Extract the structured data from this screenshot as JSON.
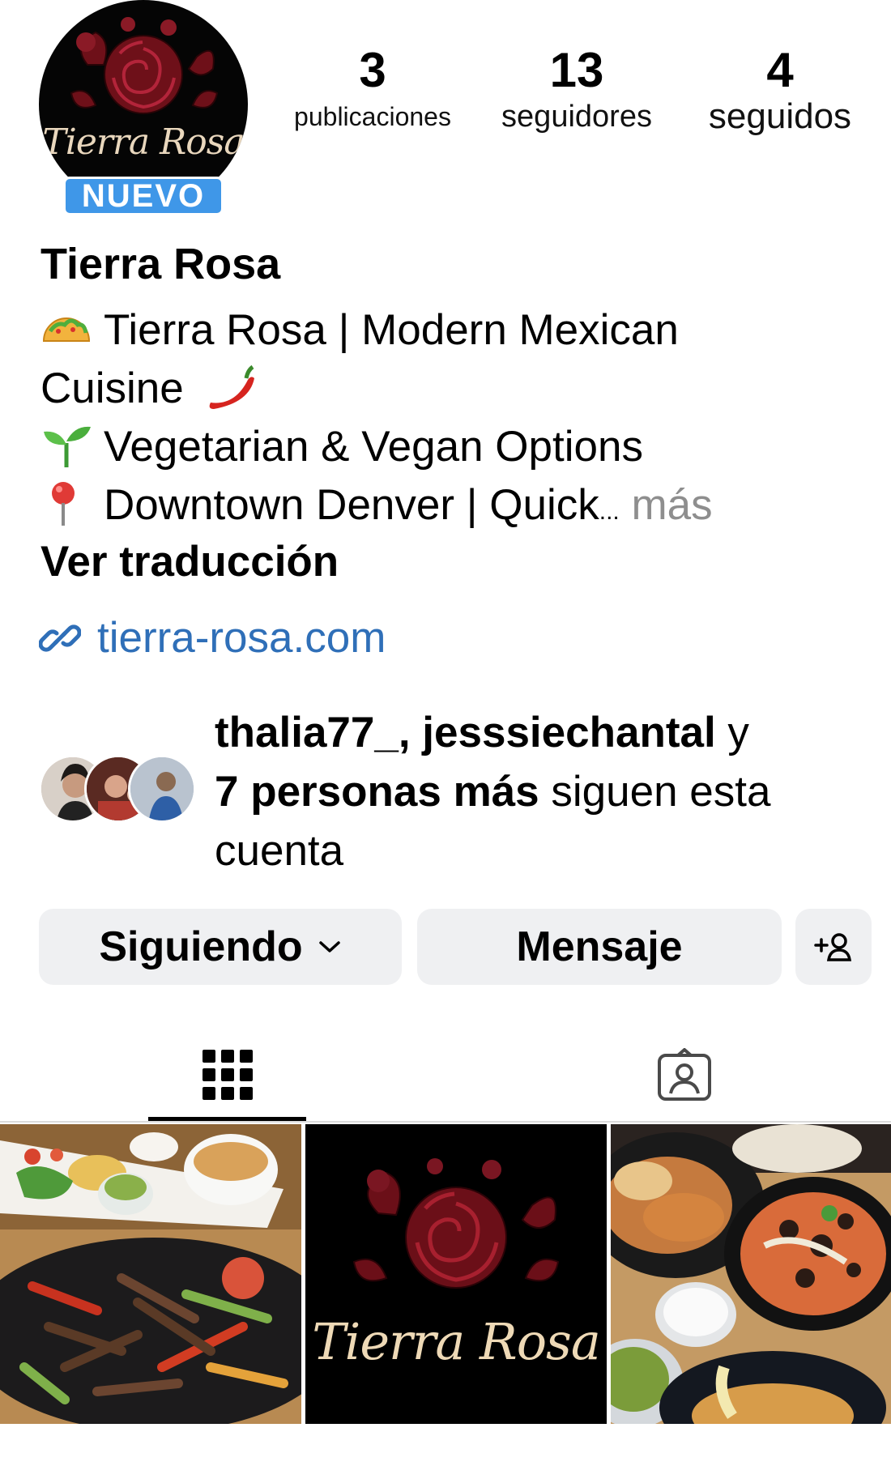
{
  "header": {
    "avatar_logo_text": "Tierra Rosa",
    "badge": "NUEVO",
    "stats": [
      {
        "value": "3",
        "label": "publicaciones"
      },
      {
        "value": "13",
        "label": "seguidores"
      },
      {
        "value": "4",
        "label": "seguidos"
      }
    ]
  },
  "profile": {
    "name": "Tierra Rosa",
    "bio": {
      "line1": "Tierra Rosa | Modern Mexican",
      "line2": "Cuisine",
      "line3": "Vegetarian & Vegan Options",
      "line4": "Downtown Denver | Quick",
      "ellipsis": "...",
      "more": "más"
    },
    "translate": "Ver traducción",
    "website": "tierra-rosa.com",
    "icons": {
      "taco": "taco-emoji",
      "pepper": "hot-pepper-emoji",
      "seedling": "seedling-emoji",
      "pin": "round-pushpin-emoji",
      "link": "link-icon"
    }
  },
  "followed_by": {
    "names": "thalia77_, jesssiechantal",
    "connector": " y",
    "others": "7 personas más",
    "suffix": " siguen esta cuenta"
  },
  "actions": {
    "following": "Siguiendo",
    "message": "Mensaje"
  },
  "tabs": [
    {
      "name": "grid",
      "icon": "grid-icon",
      "active": true
    },
    {
      "name": "tagged",
      "icon": "tagged-person-icon",
      "active": false
    }
  ],
  "posts": [
    {
      "description_icon": "fajitas-photo"
    },
    {
      "logo_text": "Tierra Rosa"
    },
    {
      "description_icon": "food-platters-photo"
    }
  ],
  "colors": {
    "link": "#2f6fb8",
    "badge": "#3f97e8",
    "button_bg": "#eff0f2",
    "muted": "#8e8e8e",
    "rose": "#7a1420"
  }
}
